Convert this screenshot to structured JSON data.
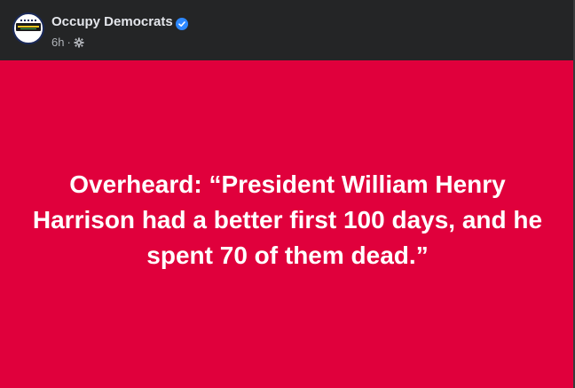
{
  "post": {
    "author": "Occupy Democrats",
    "timestamp": "6h",
    "separator": "·",
    "audience_icon": "gear-icon",
    "verified_icon": "verified-badge-icon",
    "avatar_icon": "occupy-democrats-logo",
    "background_color": "#e0003c",
    "text": "Overheard: “President William Henry Harrison had a better first 100 days, and he spent 70 of them dead.”"
  }
}
